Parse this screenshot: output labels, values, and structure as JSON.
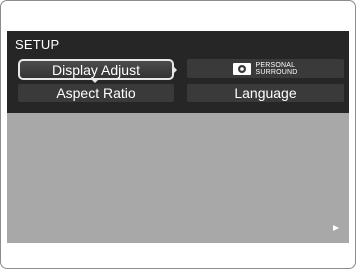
{
  "header": {
    "title": "SETUP"
  },
  "menu": {
    "display_adjust": "Display Adjust",
    "aspect_ratio": "Aspect Ratio",
    "personal_surround_line1": "PERSONAL",
    "personal_surround_line2": "SURROUND",
    "language": "Language"
  },
  "icons": {
    "personal_surround": "personal-surround-icon",
    "next_page": "right-arrow-icon"
  },
  "colors": {
    "menu_background": "#262626",
    "button_background": "#3a3a3a",
    "screen_background": "#a8a8a8",
    "selection_border": "#e8e8e8"
  }
}
